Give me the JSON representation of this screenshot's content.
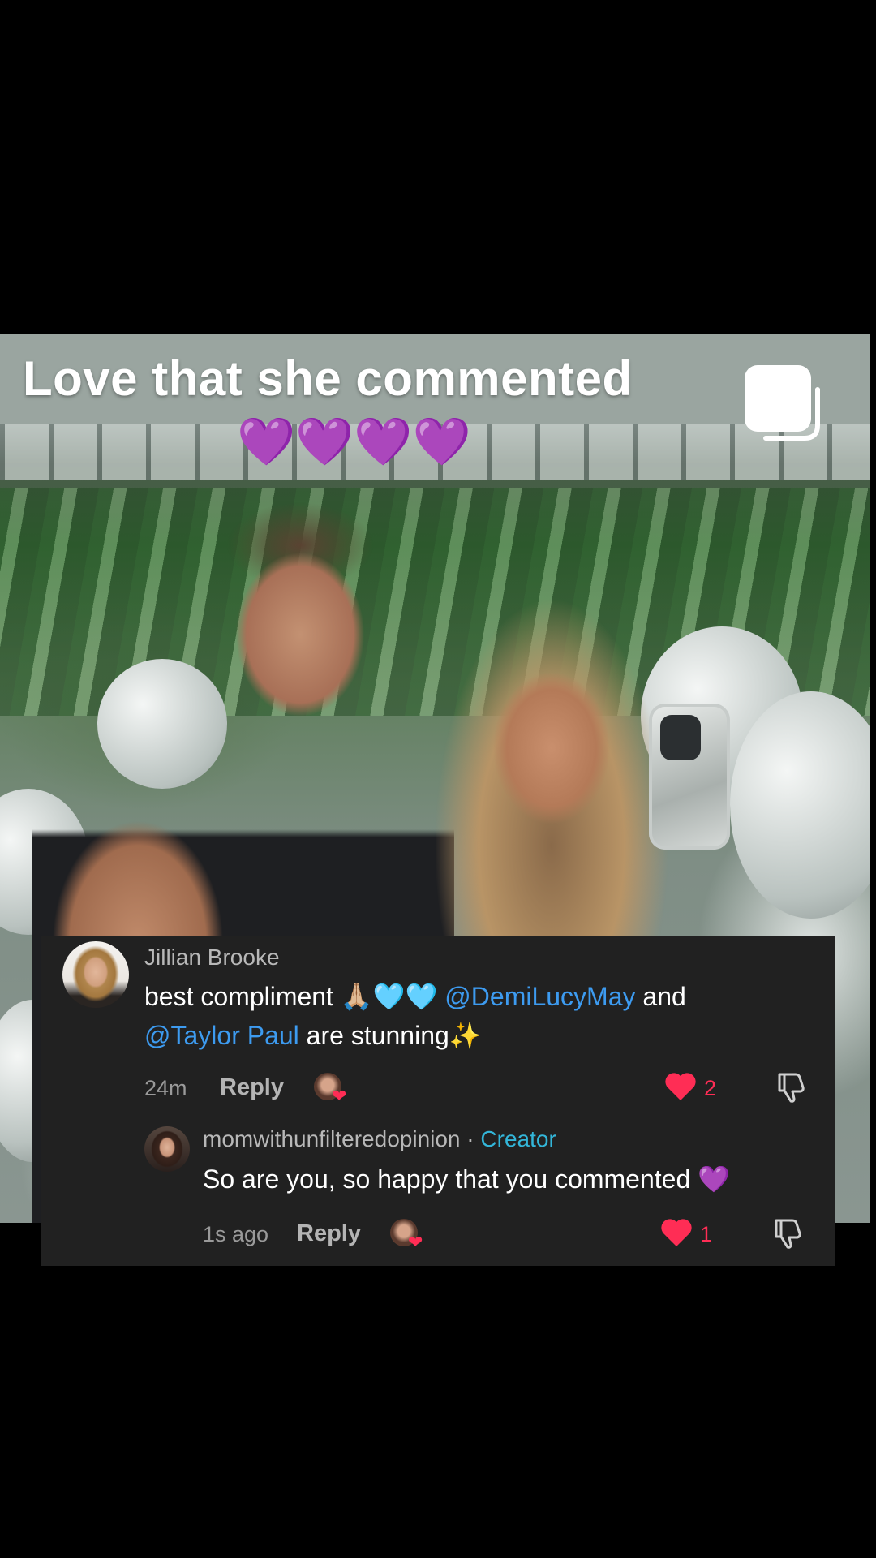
{
  "video": {
    "caption": "Love that she commented",
    "emoji_line": "💜💜💜💜"
  },
  "comment": {
    "username": "Jillian Brooke",
    "text_part1": "best compliment 🙏🏼🩵🩵 ",
    "mention1": "@DemiLucyMay",
    "text_part2": " and",
    "mention2": "@Taylor Paul",
    "text_part3": " are stunning✨",
    "time": "24m",
    "reply_label": "Reply",
    "likes": "2"
  },
  "reply": {
    "username": "momwithunfilteredopinion",
    "separator": " · ",
    "badge": "Creator",
    "text": "So are you, so happy that you commented 💜",
    "time": "1s ago",
    "reply_label": "Reply",
    "likes": "1"
  },
  "colors": {
    "card_bg": "#212121",
    "mention": "#3d9bf0",
    "creator": "#33b6d9",
    "like": "#ff2d55"
  }
}
